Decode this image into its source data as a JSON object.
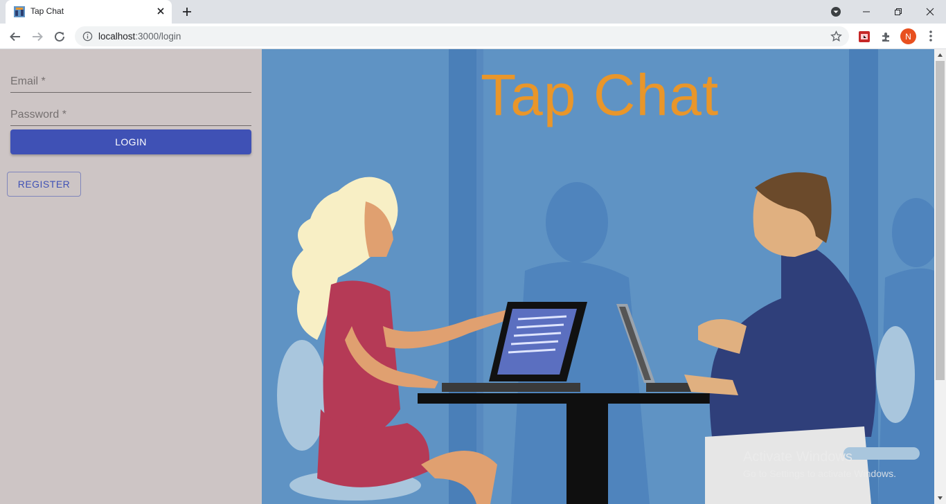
{
  "browser": {
    "tab_title": "Tap Chat",
    "url_host": "localhost",
    "url_path": ":3000/login",
    "profile_initial": "N"
  },
  "login_form": {
    "email_label": "Email *",
    "password_label": "Password *",
    "login_button": "LOGIN",
    "register_button": "REGISTER"
  },
  "hero": {
    "title": "Tap Chat"
  },
  "watermark": {
    "line1": "Activate Windows",
    "line2": "Go to Settings to activate Windows."
  },
  "colors": {
    "primary": "#3f51b5",
    "sidebar_bg": "#cdc5c5",
    "hero_bg": "#5f93c4",
    "title_orange": "#e9962a"
  },
  "icons": [
    "app-favicon-icon",
    "close-icon",
    "plus-icon",
    "back-icon",
    "forward-icon",
    "reload-icon",
    "info-icon",
    "star-icon",
    "extension-icon",
    "puzzle-icon",
    "menu-icon"
  ]
}
